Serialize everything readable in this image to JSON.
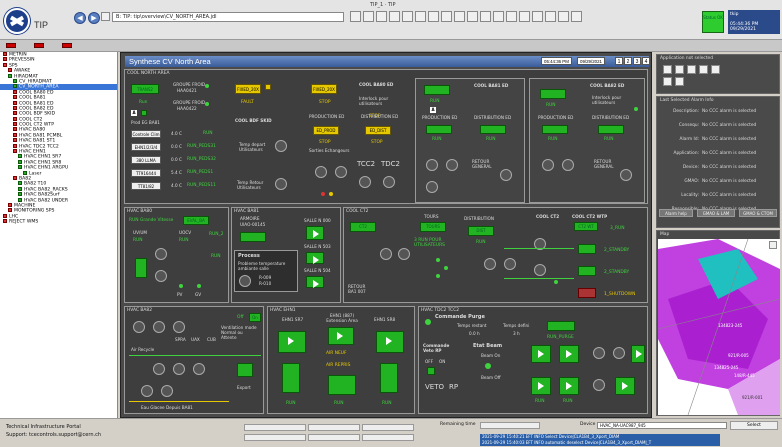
{
  "header": {
    "logo_text": "TIP",
    "window_title": "TIP_1 · TIP",
    "path": "B: TIP: tip\\overview\\CV_NORTH_AREA.jdl",
    "status_label": "Status OK",
    "user_line1": "tkip",
    "user_line2": "05:44:36 PM 09/29/2021"
  },
  "tree": {
    "items": [
      {
        "label": "METRIN",
        "color": "red",
        "indent": 0
      },
      {
        "label": "PREVESSIN",
        "color": "red",
        "indent": 0
      },
      {
        "label": "SPS",
        "color": "red",
        "indent": 0
      },
      {
        "label": "AWAKE",
        "color": "red",
        "indent": 1
      },
      {
        "label": "HIRADMAT",
        "color": "green",
        "indent": 1
      },
      {
        "label": "CV_HIRADMAT",
        "color": "green",
        "indent": 2
      },
      {
        "label": "CV_NORTH_AREA",
        "color": "green",
        "indent": 2,
        "selected": true
      },
      {
        "label": "COOL BA80 ED",
        "color": "red",
        "indent": 2
      },
      {
        "label": "COOL BA81",
        "color": "red",
        "indent": 2
      },
      {
        "label": "COOL BA81 ED",
        "color": "red",
        "indent": 2
      },
      {
        "label": "COOL BA82 ED",
        "color": "red",
        "indent": 2
      },
      {
        "label": "COOL BDF SKID",
        "color": "red",
        "indent": 2
      },
      {
        "label": "COOL CT2",
        "color": "red",
        "indent": 2
      },
      {
        "label": "COOL CT2 WTP",
        "color": "red",
        "indent": 2
      },
      {
        "label": "HVAC BA80",
        "color": "red",
        "indent": 2
      },
      {
        "label": "HVAC BA81 PCMBL",
        "color": "red",
        "indent": 2
      },
      {
        "label": "HVAC BA81 ST1",
        "color": "red",
        "indent": 2
      },
      {
        "label": "HVAC TDC2 TCC2",
        "color": "red",
        "indent": 2
      },
      {
        "label": "HVAC EHN1",
        "color": "red",
        "indent": 2
      },
      {
        "label": "HVAC EHN1 SR7",
        "color": "green",
        "indent": 3
      },
      {
        "label": "HVAC EHN1 SR8",
        "color": "green",
        "indent": 3
      },
      {
        "label": "HVAC EHN1 ARGPU",
        "color": "green",
        "indent": 3
      },
      {
        "label": "Laser",
        "color": "green",
        "indent": 4
      },
      {
        "label": "BA82",
        "color": "red",
        "indent": 2
      },
      {
        "label": "BA82 T10",
        "color": "green",
        "indent": 3
      },
      {
        "label": "HVAC BA82_RACKS",
        "color": "green",
        "indent": 3
      },
      {
        "label": "HVAC BA82Surf",
        "color": "green",
        "indent": 3
      },
      {
        "label": "HVAC BA82 UNDER",
        "color": "green",
        "indent": 3
      },
      {
        "label": "MACHINE",
        "color": "red",
        "indent": 1
      },
      {
        "label": "MONITORING SPS",
        "color": "red",
        "indent": 1
      },
      {
        "label": "LHC",
        "color": "red",
        "indent": 0
      },
      {
        "label": "REJECT WMS",
        "color": "red",
        "indent": 0
      }
    ]
  },
  "main": {
    "title": "Synthese CV North Area",
    "time": "05:44:36 PM",
    "date": "09/29/2021",
    "pages": [
      "1",
      "2",
      "3",
      "4"
    ]
  },
  "cool_north": {
    "label": "COOL NORTH AREA",
    "trans_btn": "TRANS2",
    "run_text": "Run",
    "groupe_froid_1": "GROUPE FROID",
    "haa_1": "HAA0421",
    "groupe_froid_2": "GROUPE FROID",
    "haa_2": "HAA0422",
    "prod_eg": "Prod EG BA81",
    "rows": [
      {
        "btn": "Controle Clim",
        "v": "4.0 C",
        "s": "RUN"
      },
      {
        "btn": "EHN1/2/3/4",
        "v": "0.0 C",
        "s": "RUN_PEDS31"
      },
      {
        "btn": "380 LLMA",
        "v": "0.0 C",
        "s": "RUN_PEDS32"
      },
      {
        "btn": "TT916444",
        "v": "5.4 C",
        "s": "RUN_PEDS1"
      },
      {
        "btn": "TT81/82",
        "v": "4.0 C",
        "s": "RUN_PEDS11"
      }
    ],
    "fixed_1": "FIXED_20X",
    "fault_text": "FAULT",
    "bdf_title": "COOL BDF SKID",
    "temp_depart": "Temp depart Utilisateurs",
    "temp_retour": "Temp Retour Utilisateurs",
    "ba80_title": "COOL BA80 ED",
    "fixed_2": "FIXED_20X",
    "stop_1": "STOP",
    "prod_ed": "PRODUCTION ED",
    "ed_prod_btn": "ED_PROD",
    "stop_2": "STOP",
    "sorties_ech": "Sorties Echangeurs",
    "interlock": "Interlock pour utilisateurs",
    "stop_3": "STOP",
    "distrib_ed": "DISTRIBUTION ED",
    "ed_dist_btn": "ED_DIST",
    "stop_4": "STOP",
    "tcc2": "TCC2",
    "tdc2": "TDC2",
    "ba81_title": "COOL BA81 ED",
    "run_1": "RUN",
    "prod_ed_2": "PRODUCTION ED",
    "run_2": "RUN",
    "distrib_ed_2": "DISTRIBUTION ED",
    "run_3": "RUN",
    "retour_general": "RETOUR GENERAL",
    "ba82_title": "COOL BA82 ED",
    "run_4": "RUN",
    "interlock_2": "Interlock pour utilisateurs",
    "prod_ed_3": "PRODUCTION ED",
    "distrib_ed_3": "DISTRIBUTION ED",
    "run_5": "RUN",
    "run_6": "RUN",
    "retour_general_2": "RETOUR GENERAL"
  },
  "hvac_ba80": {
    "label": "HVAC BA80",
    "title": "RUN Grande Vitesse",
    "btn": "EVAL_BA",
    "uv": "UV/UM",
    "run": "RUN",
    "ucv": "UOCV",
    "ucv_run": "RUN",
    "run_m": "RUN",
    "run_2": "RUN_2",
    "pv": "PV",
    "gv": "GV"
  },
  "hvac_ba81": {
    "label": "HVAC BA81",
    "armoire": "ARMOIRE",
    "armoire_id": "UIAO-00145",
    "salle_a": "SALLE N 000",
    "salle_b": "SALLE N 503",
    "salle_c": "SALLE N 504",
    "process": "Process",
    "probleme": "Probleme temperature ambiante salle",
    "r1": "R-009",
    "r2": "R-010"
  },
  "cool_ct2": {
    "label": "COOL CT2",
    "tours": "TOURS",
    "distribution": "DISTRIBUTION",
    "cool_ct2_title": "COOL CT2",
    "wtp_title": "COOL CT2 WTP",
    "ct2_btn": "CT2",
    "tours_btn": "TOURS",
    "dist_btn": "DIST",
    "run_ut": "3 RUN POUR UTILISATEURS",
    "run": "RUN",
    "retour": "RETOUR BA1 007",
    "run_3": "3_RUN",
    "standby_1": "2_STANDBY",
    "standby_2": "2_STANDBY",
    "shutdown": "1_SHUTDOWN",
    "wtp_btn": "CT2 WT"
  },
  "hvac_ba82": {
    "label": "HVAC BA82",
    "off": "Off",
    "on": "On",
    "ventilation": "Ventilation mode Normal ou Attente",
    "air_recycle": "Air Recycle",
    "spray": "SPRA",
    "uax": "UAX",
    "cub": "CUB",
    "export": "Export",
    "eau": "Eau Glacee Depuis BA81"
  },
  "hvac_ehn1": {
    "label": "HVAC EHN1",
    "sr7": "EHN1 SR7",
    "ext": "EHN1 (887) Extension Area",
    "sr8": "EHN1 SR8",
    "run_1": "RUN",
    "air_neuf": "AIR NEUF",
    "air_repris": "AIR REPRIS",
    "run_2": "RUN",
    "run_3": "RUN"
  },
  "hvac_tdc2": {
    "label": "HVAC TDC2 TCC2",
    "cmd_purge": "Commande Purge",
    "temps_rest": "Temps restant",
    "temps_def": "Temps defini",
    "val_rest": "0.0 h",
    "val_def": "3 h",
    "cmd_veto": "Commande Veto RP",
    "off": "OFF",
    "on": "ON",
    "etat_beam": "Etat Beam",
    "beam_on": "Beam On",
    "beam_off": "Beam Off",
    "veto": "VETO",
    "rp": "RP",
    "run_purge": "RUN_PURGE",
    "run_1": "RUN",
    "run_2": "RUN"
  },
  "right": {
    "app_title": "Application not selected",
    "alarm_title": "Last Selected Alarm Info",
    "rows": [
      {
        "k": "Description:",
        "v": "No CCC alarm is selected"
      },
      {
        "k": "Consequ:",
        "v": "No CCC alarm is selected"
      },
      {
        "k": "Alarm Id:",
        "v": "No CCC alarm is selected"
      },
      {
        "k": "Application:",
        "v": "No CCC alarm is selected"
      },
      {
        "k": "Device:",
        "v": "No CCC alarm is selected"
      },
      {
        "k": "GMAO:",
        "v": "No CCC alarm is selected"
      },
      {
        "k": "Locality:",
        "v": "No CCC alarm is selected"
      },
      {
        "k": "Responsible:",
        "v": "No CCC alarm is selected"
      }
    ],
    "btn_alarm": "Alarm help",
    "btn_gmao": "GMAO & LAM",
    "btn_gmao2": "GMAO & CTOM",
    "map_title": "Map",
    "map_labels": [
      "134823-245",
      "921/R-005",
      "134825-245",
      "148/R-445",
      "921/R-001"
    ]
  },
  "bottom": {
    "portal": "Technical Infrastructure Portal",
    "support": "Support: tcecontrols.support@cern.ch",
    "remaining": "Remaining time",
    "event1": "2021-09-29 15:40:21 EFT INFO          Select Device|CLA1B4_3_Xport_DIAM",
    "event2": "2021-09-29 15:40:03 EFT INFO     automatic deselect Device|CLA1B4_3_Xport_DIAM|_T",
    "device_label": "Device",
    "device_value": "HVAC_NA-UAC987_945",
    "select": "Select"
  }
}
